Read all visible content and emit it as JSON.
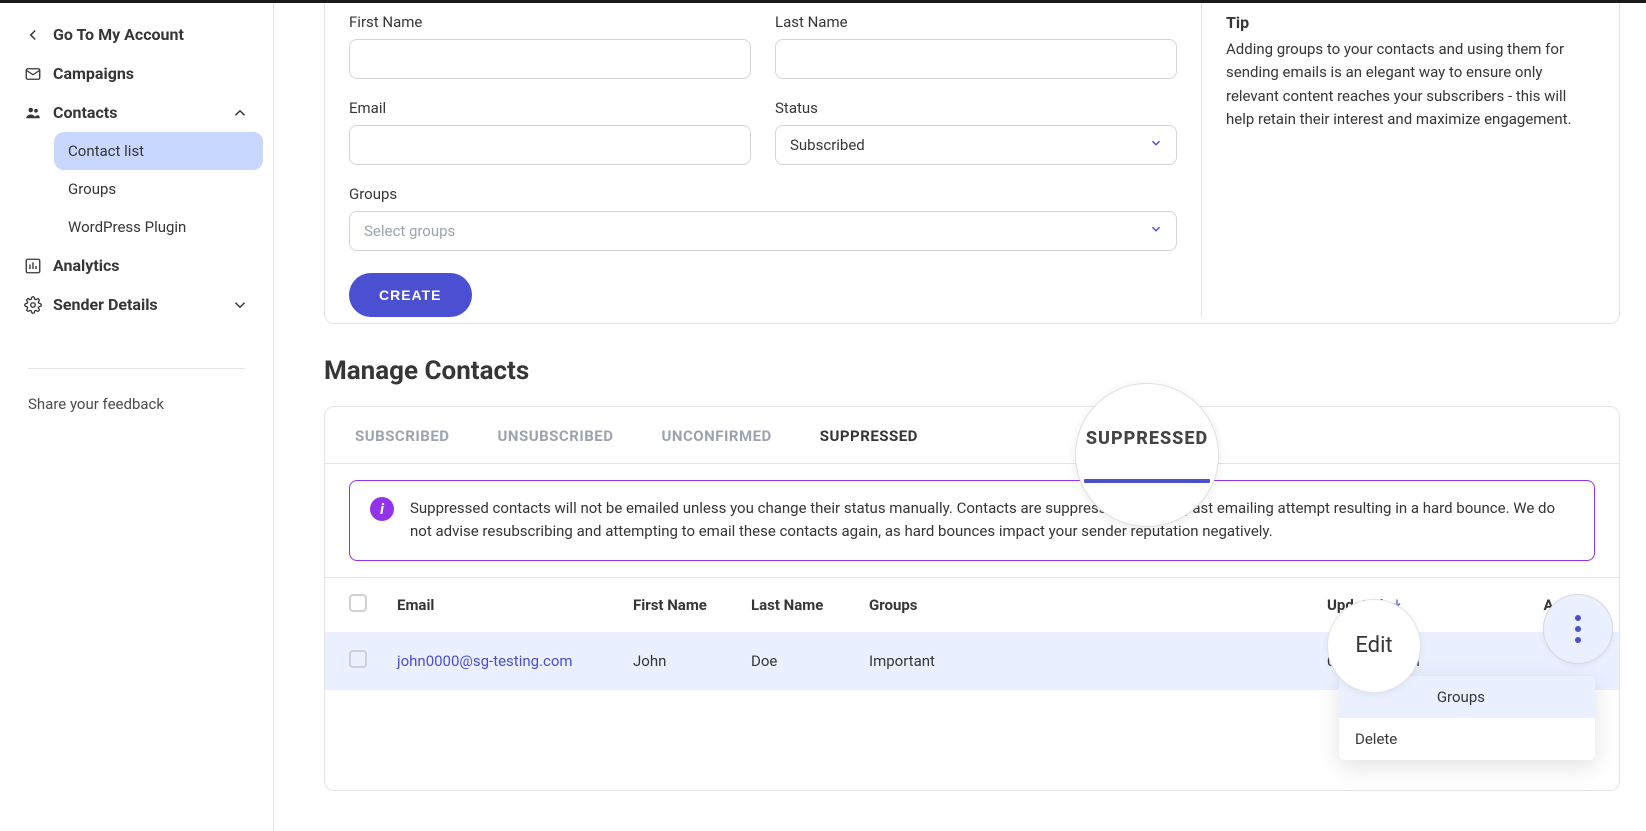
{
  "sidebar": {
    "back_label": "Go To My Account",
    "items": {
      "campaigns": "Campaigns",
      "contacts": "Contacts",
      "analytics": "Analytics",
      "sender_details": "Sender Details"
    },
    "sub": {
      "contact_list": "Contact list",
      "groups": "Groups",
      "wordpress_plugin": "WordPress Plugin"
    },
    "feedback": "Share your feedback"
  },
  "form": {
    "first_name_label": "First Name",
    "last_name_label": "Last Name",
    "email_label": "Email",
    "status_label": "Status",
    "status_value": "Subscribed",
    "groups_label": "Groups",
    "groups_placeholder": "Select groups",
    "create_btn": "CREATE"
  },
  "tip": {
    "title": "Tip",
    "body": "Adding groups to your contacts and using them for sending emails is an elegant way to ensure only relevant content reaches your subscribers - this will help retain their interest and maximize engagement."
  },
  "manage": {
    "title": "Manage Contacts",
    "tabs": {
      "subscribed": "SUBSCRIBED",
      "unsubscribed": "UNSUBSCRIBED",
      "unconfirmed": "UNCONFIRMED",
      "suppressed": "SUPPRESSED"
    },
    "magnifier_text": "SUPPRESSED",
    "info": "Suppressed contacts will not be emailed unless you change their status manually. Contacts are suppressed due to a past emailing attempt resulting in a hard bounce. We do not advise resubscribing and attempting to email these contacts again, as hard bounces impact your sender reputation negatively.",
    "headers": {
      "email": "Email",
      "first_name": "First Name",
      "last_name": "Last Name",
      "groups": "Groups",
      "updated": "Updated",
      "actions": "Actions"
    },
    "row": {
      "email": "john0000@sg-testing.com",
      "first_name": "John",
      "last_name": "Doe",
      "groups": "Important",
      "updated": "023 11:03 AM"
    },
    "menu": {
      "edit": "Edit",
      "assign_groups": "Groups",
      "delete": "Delete"
    }
  }
}
